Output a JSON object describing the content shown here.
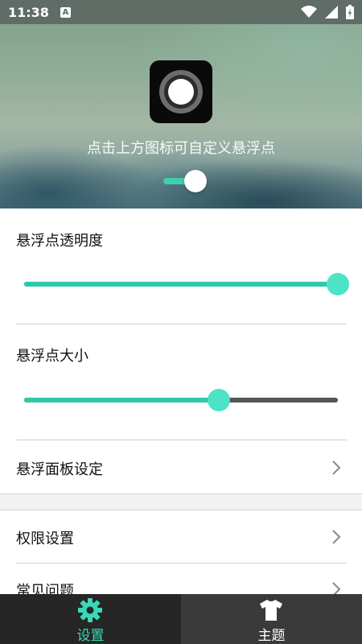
{
  "status_bar": {
    "time": "11:38",
    "notification_icon": "A"
  },
  "header": {
    "hint": "点击上方图标可自定义悬浮点",
    "toggle_on": true
  },
  "settings": {
    "opacity": {
      "label": "悬浮点透明度",
      "value": 1.0
    },
    "size": {
      "label": "悬浮点大小",
      "value": 0.62
    },
    "panel_label": "悬浮面板设定",
    "permissions_label": "权限设置",
    "faq_label": "常见问题"
  },
  "bottom_nav": {
    "items": [
      {
        "label": "设置",
        "icon": "gear-icon",
        "active": true
      },
      {
        "label": "主题",
        "icon": "tshirt-icon",
        "active": false
      }
    ]
  },
  "colors": {
    "accent": "#2ec9a6",
    "accent_light": "#4de3c6",
    "nav_bg": "#262626"
  }
}
